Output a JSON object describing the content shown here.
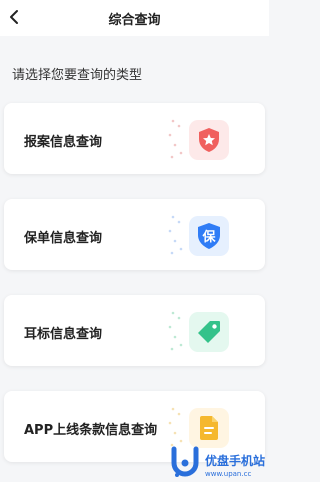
{
  "header": {
    "title": "综合查询",
    "back_icon": "chevron-left-icon"
  },
  "prompt": "请选择您要查询的类型",
  "cards": [
    {
      "label": "报案信息查询",
      "icon": "shield-star-icon",
      "icon_color": "#f0605e",
      "tile_color": "#fde9e9"
    },
    {
      "label": "保单信息查询",
      "icon": "shield-bao-icon",
      "icon_color": "#2f7cf6",
      "tile_color": "#e6f0fe",
      "icon_text": "保"
    },
    {
      "label": "耳标信息查询",
      "icon": "tag-icon",
      "icon_color": "#34c28a",
      "tile_color": "#e4f8ef"
    },
    {
      "label": "APP上线条款信息查询",
      "icon": "document-icon",
      "icon_color": "#f5b82e",
      "tile_color": "#fff5e2"
    }
  ],
  "watermark": {
    "name": "优盘手机站",
    "url": "www.upan.cc"
  }
}
